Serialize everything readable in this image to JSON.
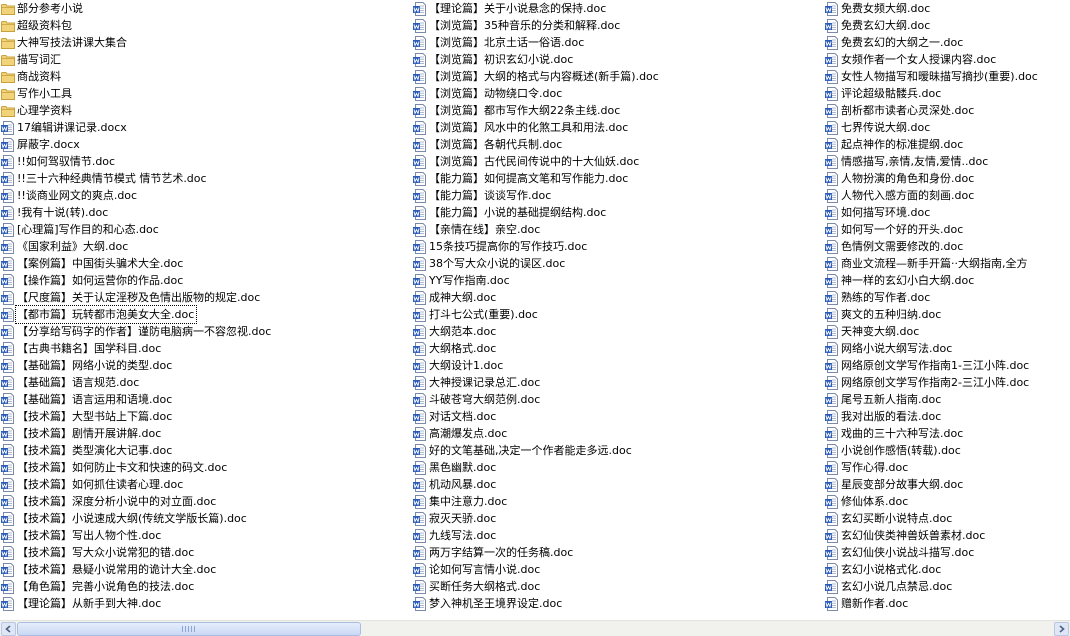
{
  "colors": {
    "folder_fill": "#f3d37a",
    "folder_edge": "#c7a13a",
    "doc_blue": "#2a5bb8",
    "scroll_track": "#f1f1ee",
    "scroll_thumb": "#c9d7f3"
  },
  "icons": {
    "folder": "folder-icon",
    "doc": "word-document-icon"
  },
  "selected_item": "【都市篇】玩转都市泡美女大全.doc",
  "columns": [
    [
      {
        "type": "folder",
        "name": "部分参考小说"
      },
      {
        "type": "folder",
        "name": "超级资料包"
      },
      {
        "type": "folder",
        "name": "大神写技法讲课大集合"
      },
      {
        "type": "folder",
        "name": "描写词汇"
      },
      {
        "type": "folder",
        "name": "商战资料"
      },
      {
        "type": "folder",
        "name": "写作小工具"
      },
      {
        "type": "folder",
        "name": "心理学资料"
      },
      {
        "type": "doc",
        "name": "17编辑讲课记录.docx"
      },
      {
        "type": "doc",
        "name": "屏蔽字.docx"
      },
      {
        "type": "doc",
        "name": "!!如何驾驭情节.doc"
      },
      {
        "type": "doc",
        "name": "!!三十六种经典情节模式 情节艺术.doc"
      },
      {
        "type": "doc",
        "name": "!!谈商业网文的爽点.doc"
      },
      {
        "type": "doc",
        "name": "!我有十说(转).doc"
      },
      {
        "type": "doc",
        "name": "[心理篇]写作目的和心态.doc"
      },
      {
        "type": "doc",
        "name": "《国家利益》大纲.doc"
      },
      {
        "type": "doc",
        "name": "【案例篇】中国街头骗术大全.doc"
      },
      {
        "type": "doc",
        "name": "【操作篇】如何运营你的作品.doc"
      },
      {
        "type": "doc",
        "name": "【尺度篇】关于认定淫秽及色情出版物的规定.doc"
      },
      {
        "type": "doc",
        "name": "【都市篇】玩转都市泡美女大全.doc"
      },
      {
        "type": "doc",
        "name": "【分享给写码字的作者】谨防电脑病一不容忽视.doc"
      },
      {
        "type": "doc",
        "name": "【古典书籍名】国学科目.doc"
      },
      {
        "type": "doc",
        "name": "【基础篇】网络小说的类型.doc"
      },
      {
        "type": "doc",
        "name": "【基础篇】语言规范.doc"
      },
      {
        "type": "doc",
        "name": "【基础篇】语言运用和语境.doc"
      },
      {
        "type": "doc",
        "name": "【技术篇】大型书站上下篇.doc"
      },
      {
        "type": "doc",
        "name": "【技术篇】剧情开展讲解.doc"
      },
      {
        "type": "doc",
        "name": "【技术篇】类型演化大记事.doc"
      },
      {
        "type": "doc",
        "name": "【技术篇】如何防止卡文和快速的码文.doc"
      },
      {
        "type": "doc",
        "name": "【技术篇】如何抓住读者心理.doc"
      },
      {
        "type": "doc",
        "name": "【技术篇】深度分析小说中的对立面.doc"
      },
      {
        "type": "doc",
        "name": "【技术篇】小说速成大纲(传统文学版长篇).doc"
      },
      {
        "type": "doc",
        "name": "【技术篇】写出人物个性.doc"
      },
      {
        "type": "doc",
        "name": "【技术篇】写大众小说常犯的错.doc"
      },
      {
        "type": "doc",
        "name": "【技术篇】悬疑小说常用的诡计大全.doc"
      },
      {
        "type": "doc",
        "name": "【角色篇】完善小说角色的技法.doc"
      },
      {
        "type": "doc",
        "name": "【理论篇】从新手到大神.doc"
      }
    ],
    [
      {
        "type": "doc",
        "name": "【理论篇】关于小说悬念的保持.doc"
      },
      {
        "type": "doc",
        "name": "【浏览篇】35种音乐的分类和解释.doc"
      },
      {
        "type": "doc",
        "name": "【浏览篇】北京土话一俗语.doc"
      },
      {
        "type": "doc",
        "name": "【浏览篇】初识玄幻小说.doc"
      },
      {
        "type": "doc",
        "name": "【浏览篇】大纲的格式与内容概述(新手篇).doc"
      },
      {
        "type": "doc",
        "name": "【浏览篇】动物绕口令.doc"
      },
      {
        "type": "doc",
        "name": "【浏览篇】都市写作大纲22条主线.doc"
      },
      {
        "type": "doc",
        "name": "【浏览篇】风水中的化煞工具和用法.doc"
      },
      {
        "type": "doc",
        "name": "【浏览篇】各朝代兵制.doc"
      },
      {
        "type": "doc",
        "name": "【浏览篇】古代民间传说中的十大仙妖.doc"
      },
      {
        "type": "doc",
        "name": "【能力篇】如何提高文笔和写作能力.doc"
      },
      {
        "type": "doc",
        "name": "【能力篇】谈谈写作.doc"
      },
      {
        "type": "doc",
        "name": "【能力篇】小说的基础提纲结构.doc"
      },
      {
        "type": "doc",
        "name": "【亲情在线】亲空.doc"
      },
      {
        "type": "doc",
        "name": "15条技巧提高你的写作技巧.doc"
      },
      {
        "type": "doc",
        "name": "38个写大众小说的误区.doc"
      },
      {
        "type": "doc",
        "name": "YY写作指南.doc"
      },
      {
        "type": "doc",
        "name": "成神大纲.doc"
      },
      {
        "type": "doc",
        "name": "打斗七公式(重要).doc"
      },
      {
        "type": "doc",
        "name": "大纲范本.doc"
      },
      {
        "type": "doc",
        "name": "大纲格式.doc"
      },
      {
        "type": "doc",
        "name": "大纲设计1.doc"
      },
      {
        "type": "doc",
        "name": "大神授课记录总汇.doc"
      },
      {
        "type": "doc",
        "name": "斗破苍穹大纲范例.doc"
      },
      {
        "type": "doc",
        "name": "对话文档.doc"
      },
      {
        "type": "doc",
        "name": "高潮爆发点.doc"
      },
      {
        "type": "doc",
        "name": "好的文笔基础,决定一个作者能走多远.doc"
      },
      {
        "type": "doc",
        "name": "黑色幽默.doc"
      },
      {
        "type": "doc",
        "name": "机动风暴.doc"
      },
      {
        "type": "doc",
        "name": "集中注意力.doc"
      },
      {
        "type": "doc",
        "name": "寂灭天骄.doc"
      },
      {
        "type": "doc",
        "name": "九线写法.doc"
      },
      {
        "type": "doc",
        "name": "两万字结算一次的任务稿.doc"
      },
      {
        "type": "doc",
        "name": "论如何写言情小说.doc"
      },
      {
        "type": "doc",
        "name": "买断任务大纲格式.doc"
      },
      {
        "type": "doc",
        "name": "梦入神机圣王境界设定.doc"
      }
    ],
    [
      {
        "type": "doc",
        "name": "免费女频大纲.doc"
      },
      {
        "type": "doc",
        "name": "免费玄幻大纲.doc"
      },
      {
        "type": "doc",
        "name": "免费玄幻的大纲之一.doc"
      },
      {
        "type": "doc",
        "name": "女频作者一个女人授课内容.doc"
      },
      {
        "type": "doc",
        "name": "女性人物描写和暧昧描写摘抄(重要).doc"
      },
      {
        "type": "doc",
        "name": "评论超级骷髅兵.doc"
      },
      {
        "type": "doc",
        "name": "剖析都市读者心灵深处.doc"
      },
      {
        "type": "doc",
        "name": "七界传说大纲.doc"
      },
      {
        "type": "doc",
        "name": "起点神作的标准提纲.doc"
      },
      {
        "type": "doc",
        "name": "情感描写,亲情,友情,爱情..doc"
      },
      {
        "type": "doc",
        "name": "人物扮演的角色和身份.doc"
      },
      {
        "type": "doc",
        "name": "人物代入感方面的刻画.doc"
      },
      {
        "type": "doc",
        "name": "如何描写环境.doc"
      },
      {
        "type": "doc",
        "name": "如何写一个好的开头.doc"
      },
      {
        "type": "doc",
        "name": "色情例文需要修改的.doc"
      },
      {
        "type": "doc",
        "name": "商业文流程—新手开篇··大纲指南,全方"
      },
      {
        "type": "doc",
        "name": "神一样的玄幻小白大纲.doc"
      },
      {
        "type": "doc",
        "name": "熟练的写作者.doc"
      },
      {
        "type": "doc",
        "name": "爽文的五种归纳.doc"
      },
      {
        "type": "doc",
        "name": "天神变大纲.doc"
      },
      {
        "type": "doc",
        "name": "网络小说大纲写法.doc"
      },
      {
        "type": "doc",
        "name": "网络原创文学写作指南1-三江小阵.doc"
      },
      {
        "type": "doc",
        "name": "网络原创文学写作指南2-三江小阵.doc"
      },
      {
        "type": "doc",
        "name": "尾号五新人指南.doc"
      },
      {
        "type": "doc",
        "name": "我对出版的看法.doc"
      },
      {
        "type": "doc",
        "name": "戏曲的三十六种写法.doc"
      },
      {
        "type": "doc",
        "name": "小说创作感悟(转载).doc"
      },
      {
        "type": "doc",
        "name": "写作心得.doc"
      },
      {
        "type": "doc",
        "name": "星辰变部分故事大纲.doc"
      },
      {
        "type": "doc",
        "name": "修仙体系.doc"
      },
      {
        "type": "doc",
        "name": "玄幻买断小说特点.doc"
      },
      {
        "type": "doc",
        "name": "玄幻仙侠类神兽妖兽素材.doc"
      },
      {
        "type": "doc",
        "name": "玄幻仙侠小说战斗描写.doc"
      },
      {
        "type": "doc",
        "name": "玄幻小说格式化.doc"
      },
      {
        "type": "doc",
        "name": "玄幻小说几点禁忌.doc"
      },
      {
        "type": "doc",
        "name": "赠新作者.doc"
      }
    ]
  ]
}
